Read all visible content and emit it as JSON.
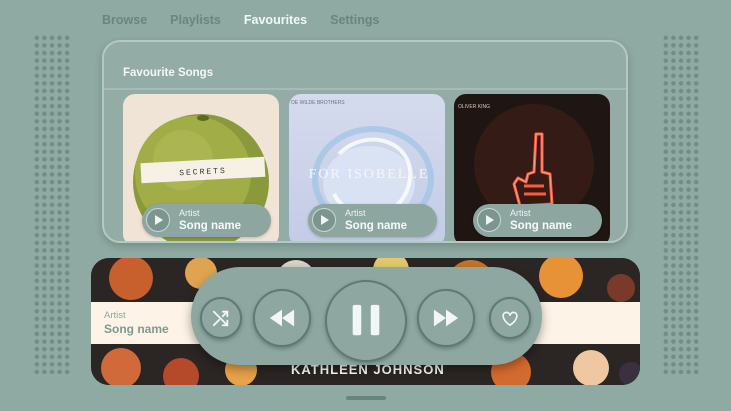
{
  "nav": {
    "tabs": [
      {
        "label": "Browse",
        "active": false
      },
      {
        "label": "Playlists",
        "active": false
      },
      {
        "label": "Favourites",
        "active": true
      },
      {
        "label": "Settings",
        "active": false
      }
    ]
  },
  "favourites": {
    "title": "Favourite Songs",
    "cards": [
      {
        "artist": "Artist",
        "song": "Song name",
        "art_text": "SECRETS",
        "art_icon": "grapefruit-art-icon"
      },
      {
        "artist": "Artist",
        "song": "Song name",
        "art_text": "FOR ISOBELLE",
        "art_top_text": "OE WILDE BROTHERS",
        "art_icon": "glass-sculpture-art-icon"
      },
      {
        "artist": "Artist",
        "song": "Song name",
        "art_top_text": "OLIVER KING",
        "art_icon": "neon-hand-art-icon"
      }
    ]
  },
  "player": {
    "artist": "Artist",
    "song": "Song name",
    "caption": "KATHLEEN JOHNSON",
    "controls": [
      {
        "name": "shuffle-button",
        "icon": "shuffle-icon"
      },
      {
        "name": "rewind-button",
        "icon": "rewind-icon"
      },
      {
        "name": "pause-button",
        "icon": "pause-icon"
      },
      {
        "name": "fast-forward-button",
        "icon": "fast-forward-icon"
      },
      {
        "name": "favourite-button",
        "icon": "heart-icon"
      }
    ]
  },
  "colors": {
    "background": "#8faaa2",
    "panel": "#93ada6",
    "accent_text": "#f4f8f5",
    "control_border": "#5f7a73",
    "strip": "#fdf3e6"
  }
}
